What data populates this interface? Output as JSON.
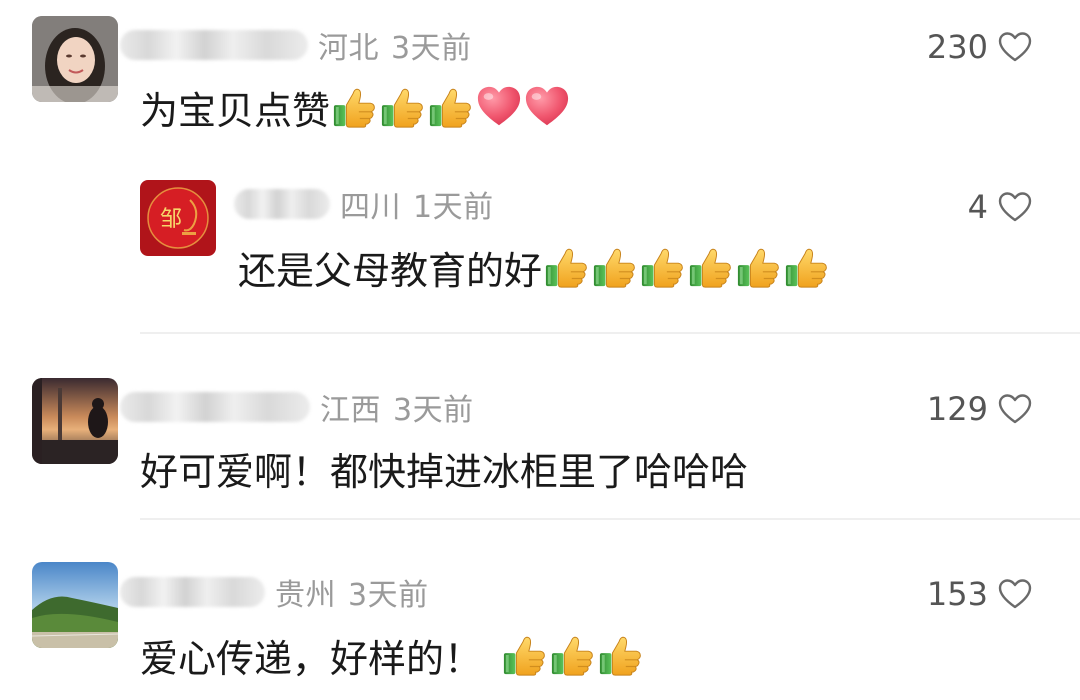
{
  "comments": [
    {
      "location": "河北",
      "time": "3天前",
      "likes": "230",
      "text": "为宝贝点赞",
      "emojis": [
        "thumbs-up",
        "thumbs-up",
        "thumbs-up",
        "red-heart",
        "red-heart"
      ]
    },
    {
      "location": "四川",
      "time": "1天前",
      "likes": "4",
      "text": "还是父母教育的好",
      "avatar_char": "邹",
      "emojis": [
        "thumbs-up",
        "thumbs-up",
        "thumbs-up",
        "thumbs-up",
        "thumbs-up",
        "thumbs-up"
      ]
    },
    {
      "location": "江西",
      "time": "3天前",
      "likes": "129",
      "text": "好可爱啊！都快掉进冰柜里了哈哈哈",
      "emojis": []
    },
    {
      "location": "贵州",
      "time": "3天前",
      "likes": "153",
      "text": "爱心传递，好样的！",
      "emojis": [
        "thumbs-up",
        "thumbs-up",
        "thumbs-up"
      ]
    }
  ],
  "icons": {
    "like": "heart-outline-icon",
    "thumbs_up": "thumbs-up-icon",
    "heart": "red-heart-icon"
  },
  "colors": {
    "meta_text": "#9a9a9a",
    "body_text": "#1a1a1a",
    "like_count": "#555555",
    "divider": "#efefef"
  }
}
